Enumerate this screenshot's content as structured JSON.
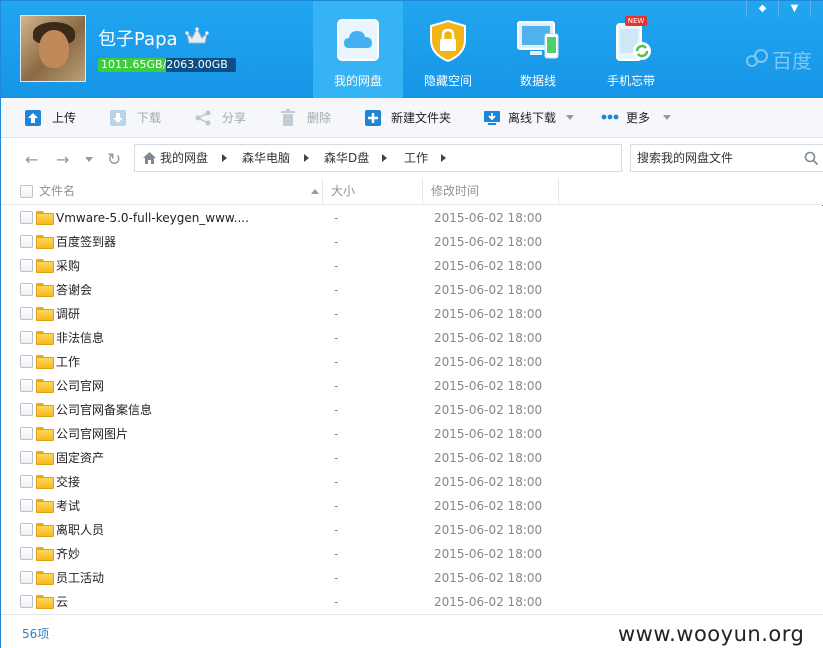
{
  "header": {
    "username": "包子Papa",
    "quota_text": "1011.65GB/2063.00GB",
    "quota_used": "1011.65GB",
    "quota_sep": "/2063.00GB",
    "quota_fraction": 0.49,
    "nav": [
      {
        "label": "我的网盘",
        "icon": "cloud-drive-icon",
        "active": true
      },
      {
        "label": "隐藏空间",
        "icon": "lock-shield-icon",
        "active": false
      },
      {
        "label": "数据线",
        "icon": "devices-icon",
        "active": false
      },
      {
        "label": "手机忘带",
        "icon": "phone-sync-icon",
        "active": false,
        "badge": "NEW"
      }
    ],
    "brand": "百度"
  },
  "toolbar": {
    "upload": "上传",
    "download": "下载",
    "share": "分享",
    "delete": "删除",
    "new_folder": "新建文件夹",
    "offline_download": "离线下载",
    "more": "更多"
  },
  "address": {
    "crumbs": [
      "我的网盘",
      "森华电脑",
      "森华D盘",
      "工作"
    ],
    "search_placeholder": "搜索我的网盘文件"
  },
  "columns": {
    "name": "文件名",
    "size": "大小",
    "modified": "修改时间"
  },
  "files": [
    {
      "name": "Vmware-5.0-full-keygen_www....",
      "size": "-",
      "time": "2015-06-02 18:00"
    },
    {
      "name": "百度签到器",
      "size": "-",
      "time": "2015-06-02 18:00"
    },
    {
      "name": "采购",
      "size": "-",
      "time": "2015-06-02 18:00"
    },
    {
      "name": "答谢会",
      "size": "-",
      "time": "2015-06-02 18:00"
    },
    {
      "name": "调研",
      "size": "-",
      "time": "2015-06-02 18:00"
    },
    {
      "name": "非法信息",
      "size": "-",
      "time": "2015-06-02 18:00"
    },
    {
      "name": "工作",
      "size": "-",
      "time": "2015-06-02 18:00"
    },
    {
      "name": "公司官网",
      "size": "-",
      "time": "2015-06-02 18:00"
    },
    {
      "name": "公司官网备案信息",
      "size": "-",
      "time": "2015-06-02 18:00"
    },
    {
      "name": "公司官网图片",
      "size": "-",
      "time": "2015-06-02 18:00"
    },
    {
      "name": "固定资产",
      "size": "-",
      "time": "2015-06-02 18:00"
    },
    {
      "name": "交接",
      "size": "-",
      "time": "2015-06-02 18:00"
    },
    {
      "name": "考试",
      "size": "-",
      "time": "2015-06-02 18:00"
    },
    {
      "name": "离职人员",
      "size": "-",
      "time": "2015-06-02 18:00"
    },
    {
      "name": "齐妙",
      "size": "-",
      "time": "2015-06-02 18:00"
    },
    {
      "name": "员工活动",
      "size": "-",
      "time": "2015-06-02 18:00"
    },
    {
      "name": "云",
      "size": "-",
      "time": "2015-06-02 18:00"
    }
  ],
  "status": {
    "count": "56项",
    "watermark": "www.wooyun.org"
  },
  "colors": {
    "header_blue": "#1695e6",
    "active_nav": "#36b3f5",
    "quota_green": "#3ccd3c",
    "folder_yellow": "#f5b91f"
  }
}
